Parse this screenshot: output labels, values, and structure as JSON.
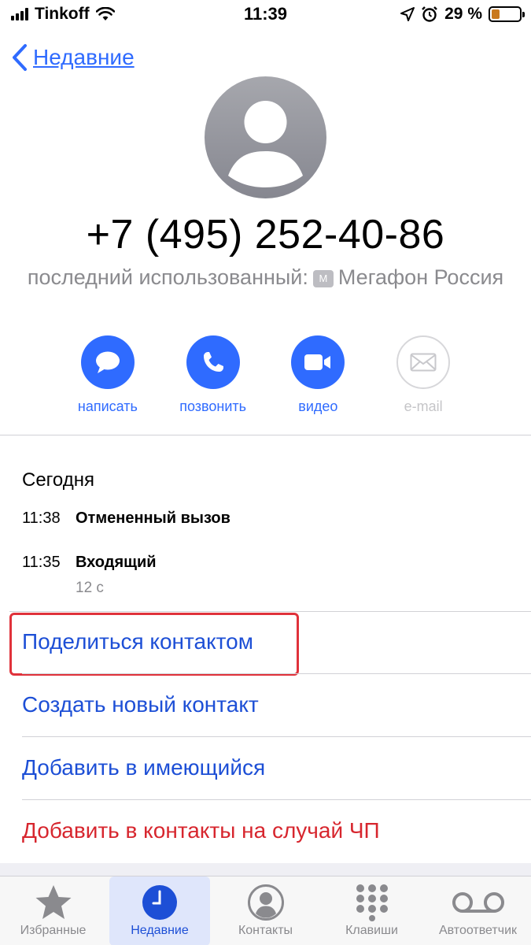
{
  "status_bar": {
    "carrier": "Tinkoff",
    "time": "11:39",
    "battery_percent": "29 %",
    "battery_level": 0.29
  },
  "nav": {
    "back_label": "Недавние"
  },
  "contact": {
    "phone": "+7 (495) 252-40-86",
    "last_used_prefix": "последний использованный:",
    "sim_badge": "M",
    "last_used_carrier": "Мегафон Россия"
  },
  "actions": [
    {
      "label": "написать",
      "icon": "message-icon"
    },
    {
      "label": "позвонить",
      "icon": "phone-icon"
    },
    {
      "label": "видео",
      "icon": "video-icon"
    },
    {
      "label": "e-mail",
      "icon": "mail-icon",
      "disabled": true
    }
  ],
  "history": {
    "title": "Сегодня",
    "calls": [
      {
        "time": "11:38",
        "type": "Отмененный вызов"
      },
      {
        "time": "11:35",
        "type": "Входящий",
        "duration": "12 с"
      }
    ]
  },
  "menu": [
    {
      "label": "Поделиться контактом"
    },
    {
      "label": "Создать новый контакт"
    },
    {
      "label": "Добавить в имеющийся"
    },
    {
      "label": "Добавить в контакты на случай ЧП"
    }
  ],
  "colors": {
    "accent": "#2f6bff",
    "link": "#1d4fd6",
    "danger": "#d7262e",
    "highlight_border": "#e0323b"
  },
  "tabs": [
    {
      "label": "Избранные",
      "icon": "star-icon"
    },
    {
      "label": "Недавние",
      "icon": "clock-icon",
      "active": true
    },
    {
      "label": "Контакты",
      "icon": "contacts-icon"
    },
    {
      "label": "Клавиши",
      "icon": "keypad-icon"
    },
    {
      "label": "Автоответчик",
      "icon": "voicemail-icon"
    }
  ]
}
